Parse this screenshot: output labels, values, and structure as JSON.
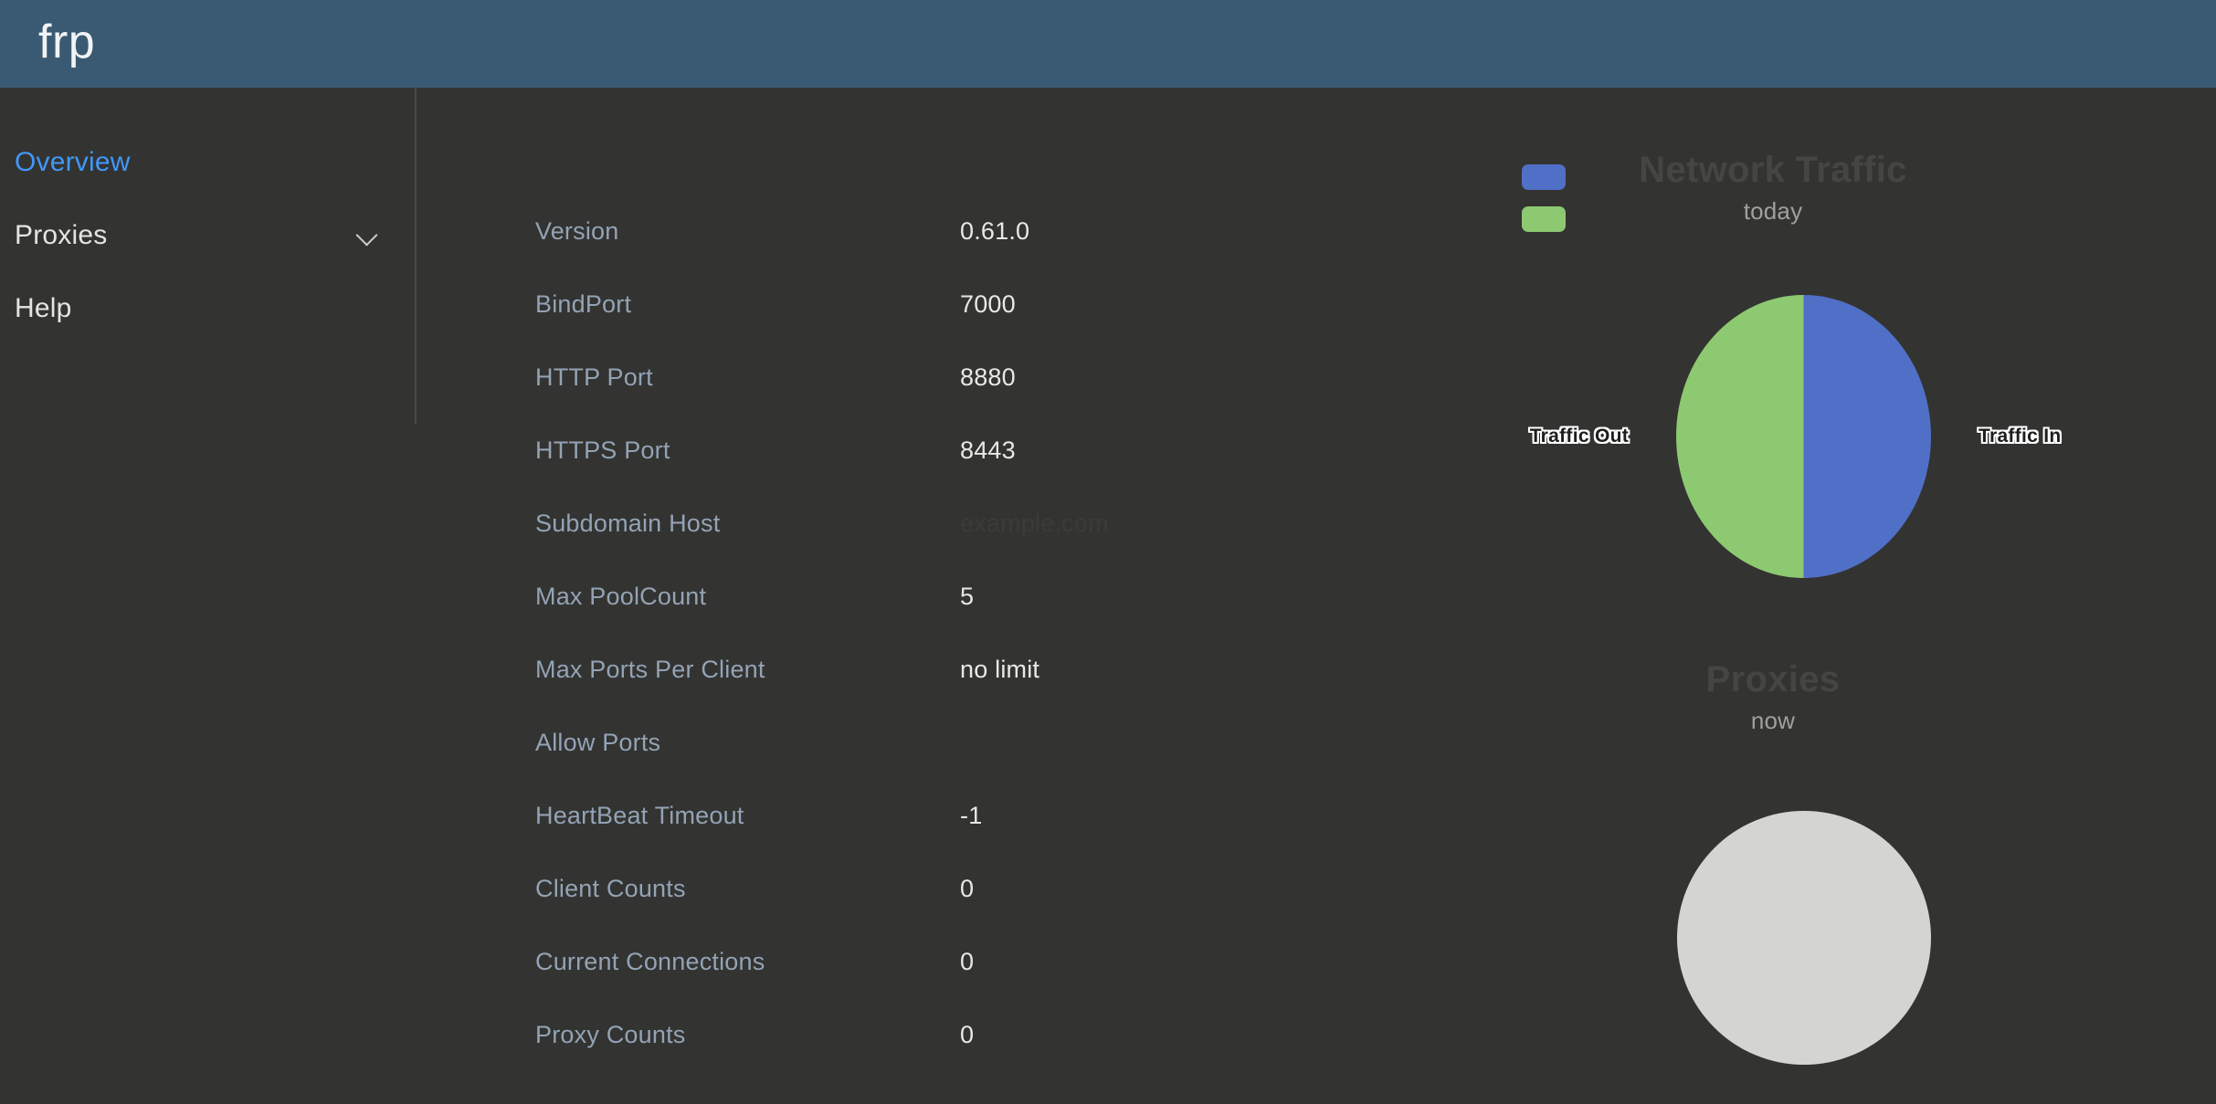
{
  "header": {
    "title": "frp"
  },
  "sidebar": {
    "items": [
      {
        "label": "Overview",
        "active": true,
        "icon": null
      },
      {
        "label": "Proxies",
        "active": false,
        "icon": "chevron-down-icon"
      },
      {
        "label": "Help",
        "active": false,
        "icon": null
      }
    ]
  },
  "server_info": {
    "rows": [
      {
        "label": "Version",
        "value": "0.61.0"
      },
      {
        "label": "BindPort",
        "value": "7000"
      },
      {
        "label": "HTTP Port",
        "value": "8880"
      },
      {
        "label": "HTTPS Port",
        "value": "8443"
      },
      {
        "label": "Subdomain Host",
        "value": "example.com",
        "ghost": true
      },
      {
        "label": "Max PoolCount",
        "value": "5"
      },
      {
        "label": "Max Ports Per Client",
        "value": "no limit"
      },
      {
        "label": "Allow Ports",
        "value": ""
      },
      {
        "label": "HeartBeat Timeout",
        "value": "-1"
      },
      {
        "label": "Client Counts",
        "value": "0"
      },
      {
        "label": "Current Connections",
        "value": "0"
      },
      {
        "label": "Proxy Counts",
        "value": "0"
      }
    ]
  },
  "colors": {
    "header_bg": "#3a5a73",
    "page_bg": "#333331",
    "accent_link": "#4098f7",
    "traffic_in": "#5070c8",
    "traffic_out": "#8dc970",
    "empty_pie": "#d4d5d3"
  },
  "chart_data": [
    {
      "type": "pie",
      "title": "Network Traffic",
      "subtitle": "today",
      "categories": [
        "Traffic In",
        "Traffic Out"
      ],
      "values": [
        50,
        50
      ],
      "colors": [
        "#5070c8",
        "#8dc970"
      ],
      "labels": [
        "Traffic In",
        "Traffic Out"
      ],
      "legend": [
        "Traffic In",
        "Traffic Out"
      ],
      "legend_position": "left",
      "annotations": [
        "Traffic Out",
        "Traffic In"
      ]
    },
    {
      "type": "pie",
      "title": "Proxies",
      "subtitle": "now",
      "categories": [],
      "values": [],
      "colors": [
        "#d4d5d3"
      ],
      "labels": [],
      "legend": [],
      "legend_position": "none",
      "annotations": []
    }
  ]
}
